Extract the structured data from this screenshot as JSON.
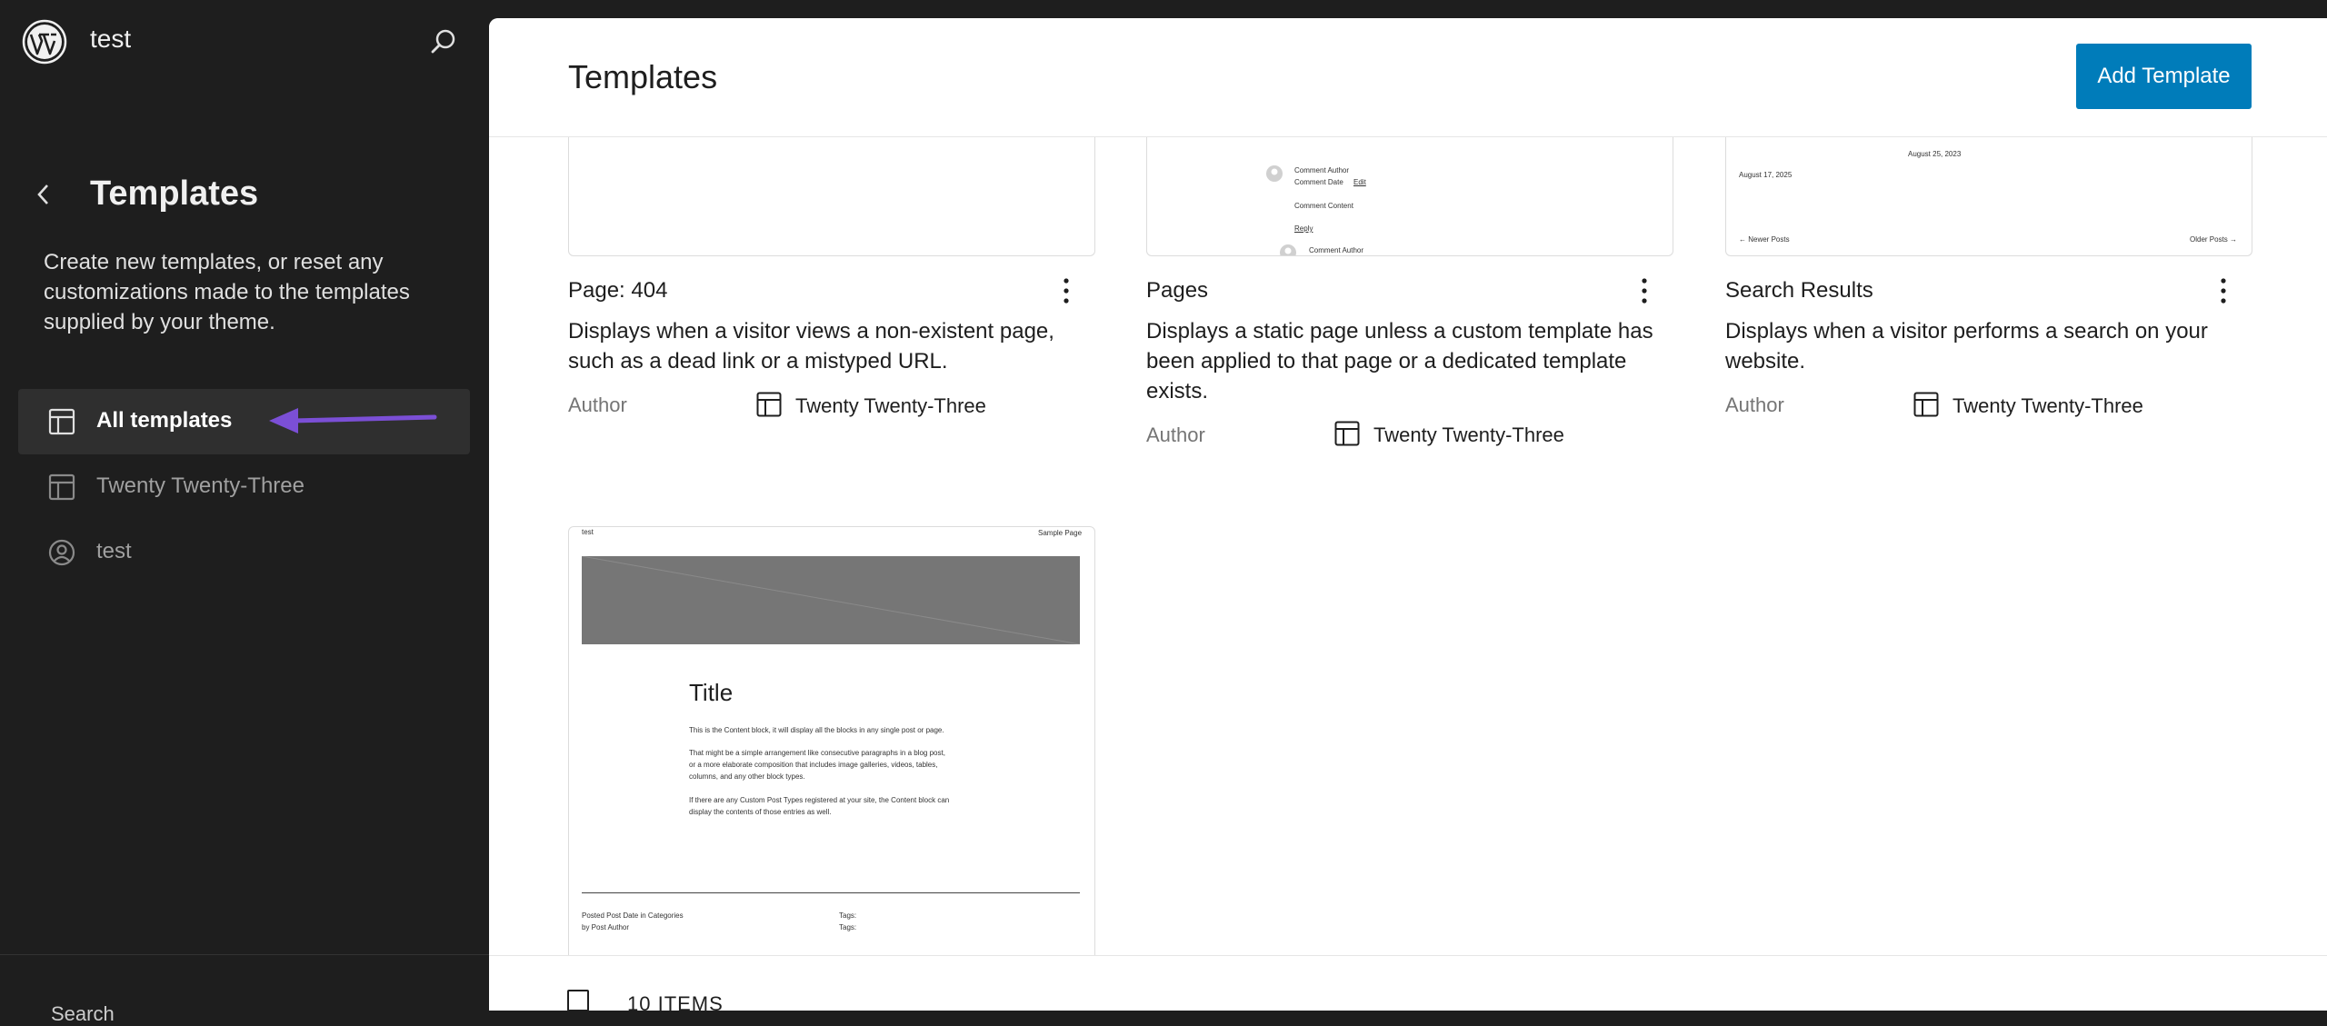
{
  "sidebar": {
    "site_name": "test",
    "title": "Templates",
    "description": "Create new templates, or reset any customizations made to the templates supplied by your theme.",
    "items": [
      {
        "label": "All templates",
        "icon": "layout-icon",
        "active": true
      },
      {
        "label": "Twenty Twenty-Three",
        "icon": "layout-icon",
        "active": false
      },
      {
        "label": "test",
        "icon": "user-circle-icon",
        "active": false
      }
    ],
    "footer_label": "Search"
  },
  "header": {
    "title": "Templates",
    "add_button": "Add Template"
  },
  "templates": [
    {
      "name": "Page: 404",
      "description": "Displays when a visitor views a non-existent page, such as a dead link or a mistyped URL.",
      "author_label": "Author",
      "theme": "Twenty Twenty-Three"
    },
    {
      "name": "Pages",
      "description": "Displays a static page unless a custom template has been applied to that page or a dedicated template exists.",
      "author_label": "Author",
      "theme": "Twenty Twenty-Three",
      "preview": {
        "comment_author": "Comment Author",
        "comment_date": "Comment Date",
        "edit": "Edit",
        "comment_content": "Comment Content",
        "reply": "Reply",
        "comment_author_2": "Comment Author"
      }
    },
    {
      "name": "Search Results",
      "description": "Displays when a visitor performs a search on your website.",
      "author_label": "Author",
      "theme": "Twenty Twenty-Three",
      "preview": {
        "date_1": "August 25, 2023",
        "date_2": "August 17, 2025",
        "newer": "← Newer Posts",
        "older": "Older Posts →"
      }
    },
    {
      "preview": {
        "site": "test",
        "nav": "Sample Page",
        "title": "Title",
        "p1": "This is the Content block, it will display all the blocks in any single post or page.",
        "p2a": "That might be a simple arrangement like consecutive paragraphs in a blog post,",
        "p2b": "or a more elaborate composition that includes image galleries, videos, tables,",
        "p2c": "columns, and any other block types.",
        "p3a": "If there are any Custom Post Types registered at your site, the Content block can",
        "p3b": "display the contents of those entries as well.",
        "meta1": "Posted Post Date in Categories",
        "meta2": "by Post Author",
        "tags1": "Tags:",
        "tags2": "Tags:"
      }
    }
  ],
  "footer": {
    "count": "10 ITEMS"
  },
  "colors": {
    "accent": "#007cba",
    "annotation_arrow": "#7b4fd6",
    "sidebar_bg": "#1e1e1e"
  }
}
